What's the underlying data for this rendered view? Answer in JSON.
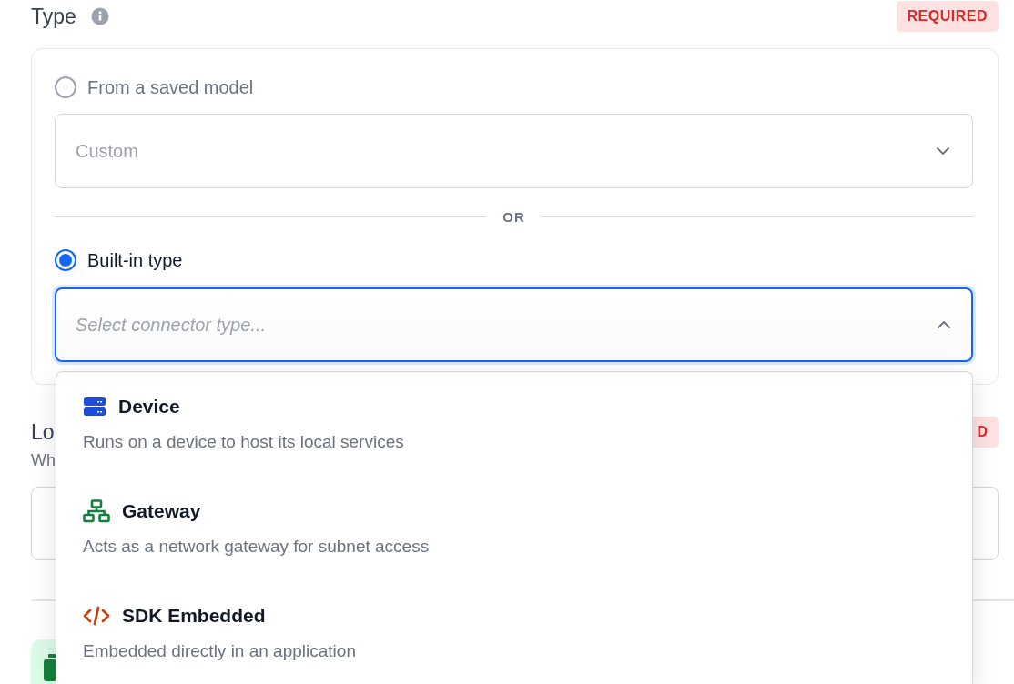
{
  "type_section": {
    "title": "Type",
    "badge": "REQUIRED",
    "options": [
      {
        "label": "From a saved model",
        "selected": false,
        "select": {
          "value": "Custom",
          "expanded": false
        }
      },
      {
        "label": "Built-in type",
        "selected": true,
        "select": {
          "placeholder": "Select connector type...",
          "expanded": true
        }
      }
    ],
    "separator": "OR"
  },
  "location_section": {
    "title": "Lo",
    "badge": "D",
    "subtitle": "Wh"
  },
  "dropdown": {
    "items": [
      {
        "kind": "device",
        "title": "Device",
        "description": "Runs on a device to host its local services"
      },
      {
        "kind": "gateway",
        "title": "Gateway",
        "description": "Acts as a network gateway for subnet access"
      },
      {
        "kind": "sdk",
        "title": "SDK Embedded",
        "description": "Embedded directly in an application"
      }
    ]
  }
}
